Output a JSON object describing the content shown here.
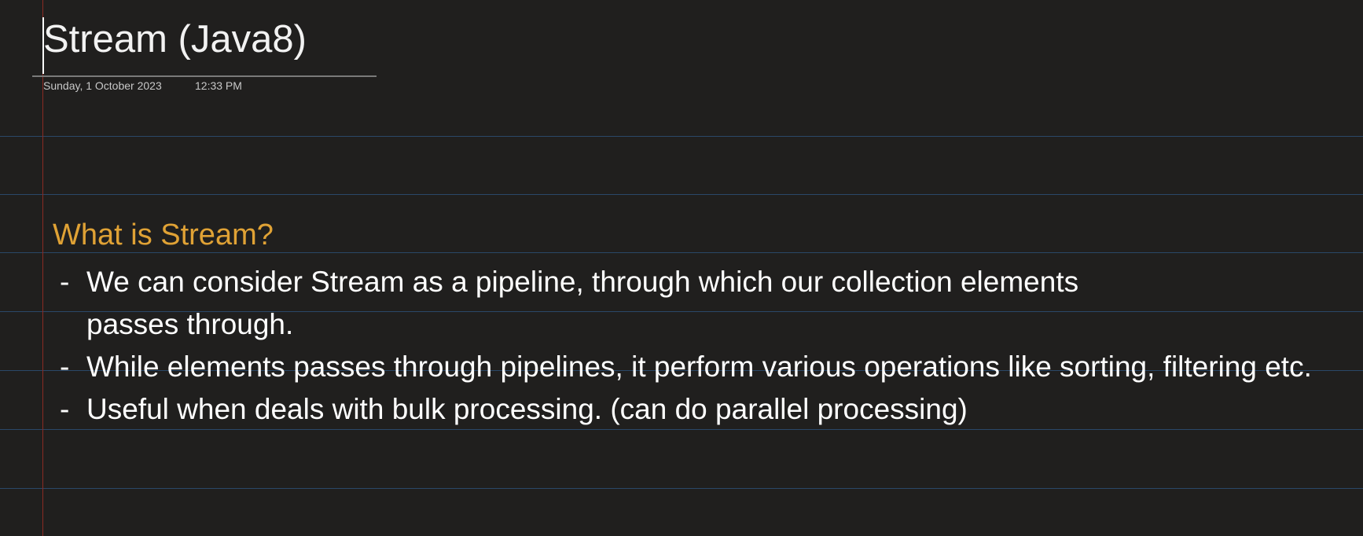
{
  "page": {
    "title": "Stream (Java8)",
    "date": "Sunday, 1 October 2023",
    "time": "12:33 PM"
  },
  "content": {
    "heading": "What is Stream?",
    "bullets": [
      {
        "dash": "-",
        "text": "We can consider Stream as a pipeline, through which our collection elements passes through."
      },
      {
        "dash": "-",
        "text": "While elements passes through pipelines, it perform various operations like sorting, filtering etc."
      },
      {
        "dash": "-",
        "text": "Useful when deals with bulk processing. (can do parallel processing)"
      }
    ]
  },
  "colors": {
    "background": "#201f1e",
    "rule_lines": "#2a4868",
    "margin_line": "#8b2a23",
    "heading": "#e0a235",
    "text": "#ffffff"
  }
}
